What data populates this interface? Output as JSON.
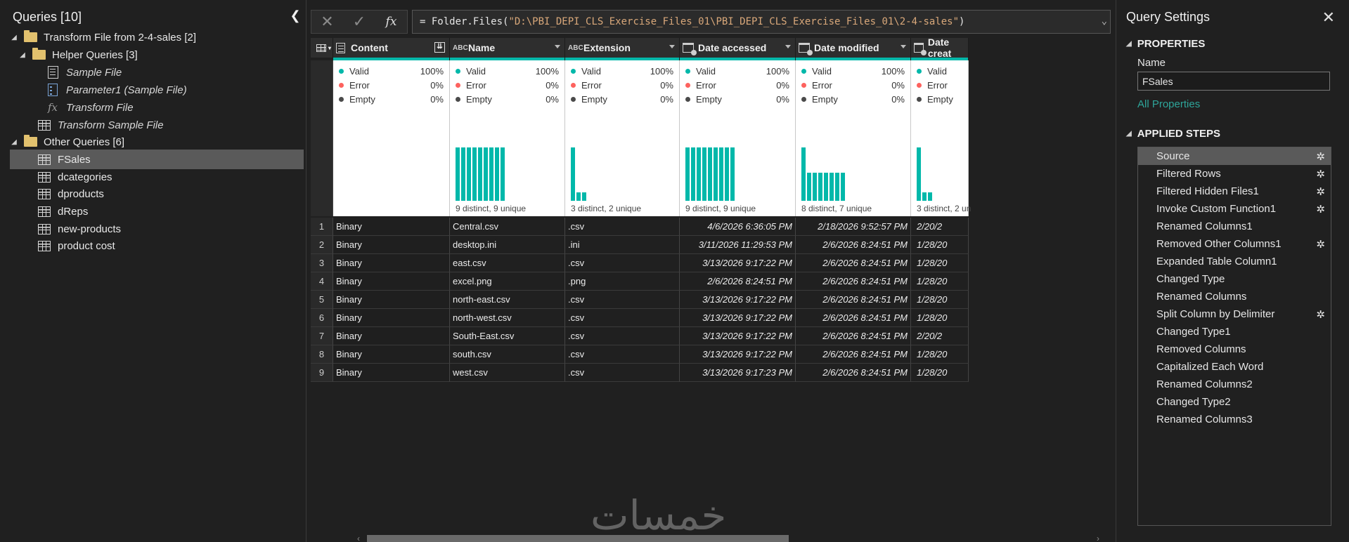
{
  "queries_pane": {
    "title": "Queries [10]",
    "collapse_glyph": "❮",
    "items": [
      {
        "label": "Transform File from 2-4-sales [2]",
        "icon": "folder-icon",
        "group": true,
        "italic": false
      },
      {
        "label": "Helper Queries [3]",
        "icon": "folder-icon",
        "group": true,
        "italic": false
      },
      {
        "label": "Sample File",
        "icon": "document-icon",
        "group": false,
        "italic": true
      },
      {
        "label": "Parameter1 (Sample File)",
        "icon": "parameter-icon",
        "group": false,
        "italic": true
      },
      {
        "label": "Transform File",
        "icon": "function-icon",
        "group": false,
        "italic": true
      },
      {
        "label": "Transform Sample File",
        "icon": "table-icon",
        "group": false,
        "italic": true
      },
      {
        "label": "Other Queries [6]",
        "icon": "folder-icon",
        "group": true,
        "italic": false
      },
      {
        "label": "FSales",
        "icon": "table-icon",
        "group": false,
        "italic": false,
        "selected": true
      },
      {
        "label": "dcategories",
        "icon": "table-icon",
        "group": false,
        "italic": false
      },
      {
        "label": "dproducts",
        "icon": "table-icon",
        "group": false,
        "italic": false
      },
      {
        "label": "dReps",
        "icon": "table-icon",
        "group": false,
        "italic": false
      },
      {
        "label": "new-products",
        "icon": "table-icon",
        "group": false,
        "italic": false
      },
      {
        "label": "product cost",
        "icon": "table-icon",
        "group": false,
        "italic": false
      }
    ]
  },
  "formula_bar": {
    "cancel_glyph": "✕",
    "commit_glyph": "✓",
    "fx_label": "fx",
    "prefix": "= Folder.Files(",
    "path": "\"D:\\PBI_DEPI_CLS_Exercise_Files_01\\PBI_DEPI_CLS_Exercise_Files_01\\2-4-sales\"",
    "suffix": ")"
  },
  "grid": {
    "columns": [
      {
        "name": "Content",
        "type": "binary",
        "valid": "100%",
        "error": "0%",
        "empty": "0%",
        "distinct": "",
        "bars": []
      },
      {
        "name": "Name",
        "type": "ABC",
        "valid": "100%",
        "error": "0%",
        "empty": "0%",
        "distinct": "9 distinct, 9 unique",
        "bars": [
          1,
          1,
          1,
          1,
          1,
          1,
          1,
          1,
          1
        ]
      },
      {
        "name": "Extension",
        "type": "ABC",
        "valid": "100%",
        "error": "0%",
        "empty": "0%",
        "distinct": "3 distinct, 2 unique",
        "bars": [
          1,
          0.16,
          0.16
        ]
      },
      {
        "name": "Date accessed",
        "type": "datetime",
        "valid": "100%",
        "error": "0%",
        "empty": "0%",
        "distinct": "9 distinct, 9 unique",
        "bars": [
          1,
          1,
          1,
          1,
          1,
          1,
          1,
          1,
          1
        ]
      },
      {
        "name": "Date modified",
        "type": "datetime",
        "valid": "100%",
        "error": "0%",
        "empty": "0%",
        "distinct": "8 distinct, 7 unique",
        "bars": [
          1,
          0.52,
          0.52,
          0.52,
          0.52,
          0.52,
          0.52,
          0.52
        ]
      },
      {
        "name": "Date creat",
        "type": "datetime",
        "valid": "",
        "error": "",
        "empty": "",
        "distinct": "3 distinct, 2 un",
        "bars": [
          1,
          0.16,
          0.16
        ]
      }
    ],
    "profile_labels": {
      "valid": "Valid",
      "error": "Error",
      "empty": "Empty"
    },
    "colors": {
      "valid": "#01b8aa",
      "error": "#fd625e",
      "empty": "#4a4a4a",
      "accent": "#01b8aa"
    },
    "rows": [
      [
        "1",
        "Binary",
        "Central.csv",
        ".csv",
        "4/6/2026 6:36:05 PM",
        "2/18/2026 9:52:57 PM",
        "2/20/2"
      ],
      [
        "2",
        "Binary",
        "desktop.ini",
        ".ini",
        "3/11/2026 11:29:53 PM",
        "2/6/2026 8:24:51 PM",
        "1/28/20"
      ],
      [
        "3",
        "Binary",
        "east.csv",
        ".csv",
        "3/13/2026 9:17:22 PM",
        "2/6/2026 8:24:51 PM",
        "1/28/20"
      ],
      [
        "4",
        "Binary",
        "excel.png",
        ".png",
        "2/6/2026 8:24:51 PM",
        "2/6/2026 8:24:51 PM",
        "1/28/20"
      ],
      [
        "5",
        "Binary",
        "north-east.csv",
        ".csv",
        "3/13/2026 9:17:22 PM",
        "2/6/2026 8:24:51 PM",
        "1/28/20"
      ],
      [
        "6",
        "Binary",
        "north-west.csv",
        ".csv",
        "3/13/2026 9:17:22 PM",
        "2/6/2026 8:24:51 PM",
        "1/28/20"
      ],
      [
        "7",
        "Binary",
        "South-East.csv",
        ".csv",
        "3/13/2026 9:17:22 PM",
        "2/6/2026 8:24:51 PM",
        "2/20/2"
      ],
      [
        "8",
        "Binary",
        "south.csv",
        ".csv",
        "3/13/2026 9:17:22 PM",
        "2/6/2026 8:24:51 PM",
        "1/28/20"
      ],
      [
        "9",
        "Binary",
        "west.csv",
        ".csv",
        "3/13/2026 9:17:23 PM",
        "2/6/2026 8:24:51 PM",
        "1/28/20"
      ]
    ]
  },
  "watermark": "خمسات",
  "settings_pane": {
    "title": "Query Settings",
    "close_glyph": "✕",
    "properties_heading": "PROPERTIES",
    "name_label": "Name",
    "name_value": "FSales",
    "all_properties_link": "All Properties",
    "applied_steps_heading": "APPLIED STEPS",
    "steps": [
      {
        "label": "Source",
        "gear": true,
        "selected": true
      },
      {
        "label": "Filtered Rows",
        "gear": true
      },
      {
        "label": "Filtered Hidden Files1",
        "gear": true
      },
      {
        "label": "Invoke Custom Function1",
        "gear": true
      },
      {
        "label": "Renamed Columns1",
        "gear": false
      },
      {
        "label": "Removed Other Columns1",
        "gear": true
      },
      {
        "label": "Expanded Table Column1",
        "gear": false
      },
      {
        "label": "Changed Type",
        "gear": false
      },
      {
        "label": "Renamed Columns",
        "gear": false
      },
      {
        "label": "Split Column by Delimiter",
        "gear": true
      },
      {
        "label": "Changed Type1",
        "gear": false
      },
      {
        "label": "Removed Columns",
        "gear": false
      },
      {
        "label": "Capitalized Each Word",
        "gear": false
      },
      {
        "label": "Renamed Columns2",
        "gear": false
      },
      {
        "label": "Changed Type2",
        "gear": false
      },
      {
        "label": "Renamed Columns3",
        "gear": false
      }
    ]
  }
}
